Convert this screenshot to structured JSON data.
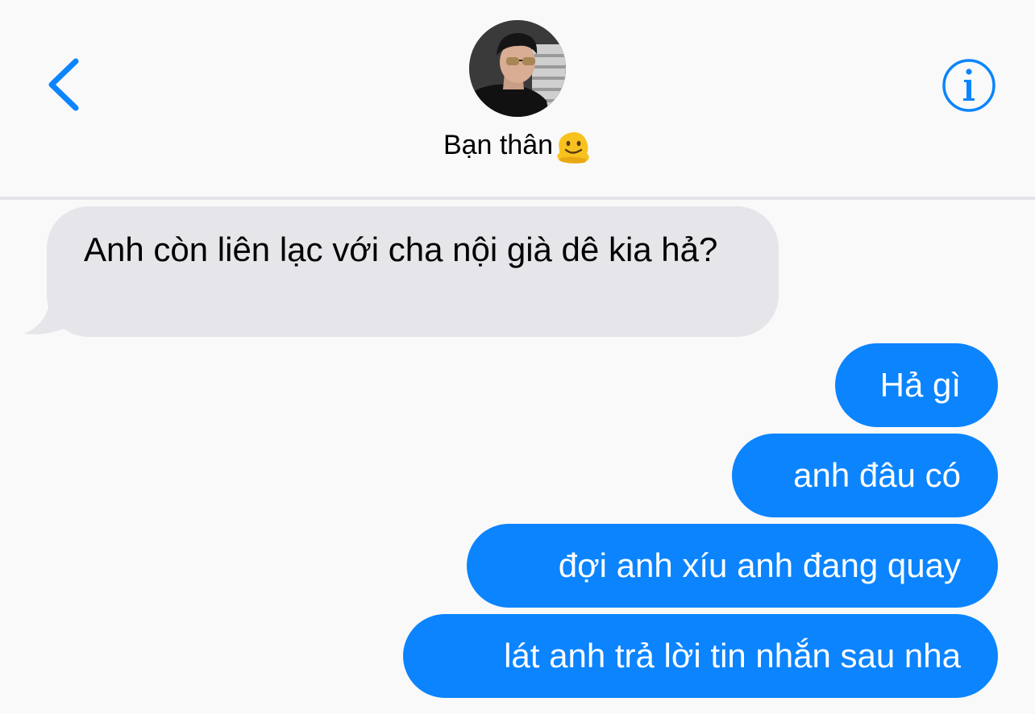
{
  "header": {
    "back_icon": "chevron-left-icon",
    "info_icon": "info-circle-icon",
    "contact_name": "Bạn thân",
    "contact_emoji": "melting-face-emoji",
    "accent_color": "#0b84fe"
  },
  "messages": [
    {
      "direction": "incoming",
      "text": "Anh còn liên lạc với cha nội già dê kia hả?"
    },
    {
      "direction": "outgoing",
      "text": "Hả gì"
    },
    {
      "direction": "outgoing",
      "text": "anh đâu có"
    },
    {
      "direction": "outgoing",
      "text": "đợi anh xíu anh đang quay"
    },
    {
      "direction": "outgoing",
      "text": "lát anh trả lời tin nhắn sau nha"
    }
  ],
  "colors": {
    "incoming_bubble": "#e5e5ea",
    "outgoing_bubble": "#0b84fe",
    "background": "#f9f9f9"
  }
}
